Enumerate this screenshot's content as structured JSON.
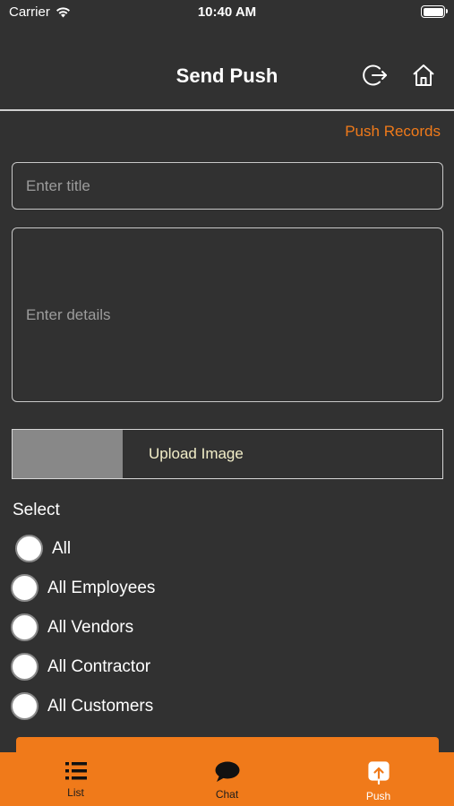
{
  "status_bar": {
    "carrier": "Carrier",
    "time": "10:40 AM"
  },
  "header": {
    "title": "Send Push",
    "logout_icon": "logout-icon",
    "home_icon": "home-icon"
  },
  "push_records_link": "Push Records",
  "form": {
    "title_placeholder": "Enter title",
    "details_placeholder": "Enter details",
    "upload_label": "Upload Image",
    "select_label": "Select",
    "options": [
      "All",
      "All Employees",
      "All Vendors",
      "All Contractor",
      "All Customers"
    ]
  },
  "tabs": [
    {
      "label": "List",
      "icon": "list-icon"
    },
    {
      "label": "Chat",
      "icon": "chat-bubble-icon"
    },
    {
      "label": "Push",
      "icon": "upload-icon",
      "active": true
    }
  ],
  "colors": {
    "accent": "#f07a1a",
    "background": "#313131",
    "upload_text": "#f2eec8"
  }
}
